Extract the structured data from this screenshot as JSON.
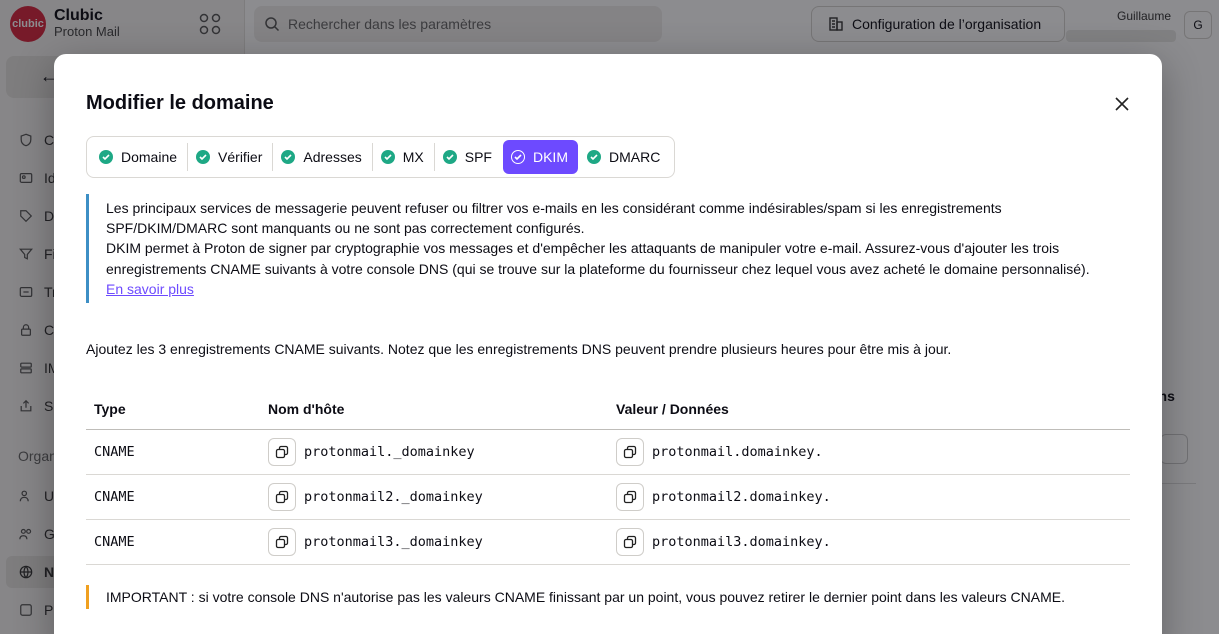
{
  "background": {
    "brand": {
      "logo_text": "clubic",
      "name": "Clubic",
      "product": "Proton Mail"
    },
    "search": {
      "placeholder": "Rechercher dans les paramètres"
    },
    "org_button": "Configuration de l’organisation",
    "user": {
      "name": "Guillaume",
      "initial": "G"
    },
    "nav": [
      {
        "label": "C"
      },
      {
        "label": "Id"
      },
      {
        "label": "D"
      },
      {
        "label": "Fi"
      },
      {
        "label": "Tr"
      },
      {
        "label": "C"
      },
      {
        "label": "IM"
      },
      {
        "label": "Sa"
      }
    ],
    "org_section": "Organ",
    "org_nav": [
      {
        "label": "U"
      },
      {
        "label": "G"
      },
      {
        "label": "N"
      },
      {
        "label": "Pr"
      }
    ],
    "column_fragment": "ons"
  },
  "modal": {
    "title": "Modifier le domaine",
    "steps": [
      {
        "label": "Domaine",
        "active": false
      },
      {
        "label": "Vérifier",
        "active": false
      },
      {
        "label": "Adresses",
        "active": false
      },
      {
        "label": "MX",
        "active": false
      },
      {
        "label": "SPF",
        "active": false
      },
      {
        "label": "DKIM",
        "active": true
      },
      {
        "label": "DMARC",
        "active": false
      }
    ],
    "info_para1": "Les principaux services de messagerie peuvent refuser ou filtrer vos e-mails en les considérant comme indésirables/spam si les enregistrements SPF/DKIM/DMARC sont manquants ou ne sont pas correctement configurés.",
    "info_para2": "DKIM permet à Proton de signer par cryptographie vos messages et d'empêcher les attaquants de manipuler votre e-mail. Assurez-vous d'ajouter les trois enregistrements CNAME suivants à votre console DNS (qui se trouve sur la plateforme du fournisseur chez lequel vous avez acheté le domaine personnalisé).",
    "learn_more": "En savoir plus",
    "instruction": "Ajoutez les 3 enregistrements CNAME suivants. Notez que les enregistrements DNS peuvent prendre plusieurs heures pour être mis à jour.",
    "table": {
      "headers": {
        "type": "Type",
        "host": "Nom d'hôte",
        "value": "Valeur / Données"
      },
      "rows": [
        {
          "type": "CNAME",
          "host": "protonmail._domainkey",
          "value": "protonmail.domainkey."
        },
        {
          "type": "CNAME",
          "host": "protonmail2._domainkey",
          "value": "protonmail2.domainkey."
        },
        {
          "type": "CNAME",
          "host": "protonmail3._domainkey",
          "value": "protonmail3.domainkey."
        }
      ]
    },
    "warning": "IMPORTANT : si votre console DNS n'autorise pas les valeurs CNAME finissant par un point, vous pouvez retirer le dernier point dans les valeurs CNAME."
  },
  "colors": {
    "accent": "#6d4aff",
    "success": "#1ea885",
    "info_border": "#3d8fc5",
    "warning_border": "#f0a020"
  }
}
